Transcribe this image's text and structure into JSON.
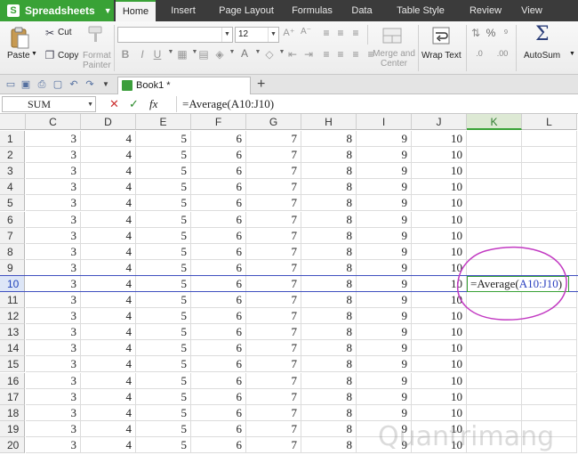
{
  "menu": {
    "app_label": "Spreadsheets",
    "tabs": [
      "Home",
      "Insert",
      "Page Layout",
      "Formulas",
      "Data",
      "Table Style",
      "Review",
      "View"
    ],
    "active_tab": "Home"
  },
  "ribbon": {
    "paste": "Paste",
    "cut": "Cut",
    "copy": "Copy",
    "format_painter": "Format Painter",
    "font_name": "",
    "font_size": "12",
    "bold": "B",
    "italic": "I",
    "underline": "U",
    "merge_center": "Merge and Center",
    "wrap_text": "Wrap Text",
    "percent": "%",
    "autosum": "AutoSum"
  },
  "document": {
    "tab_title": "Book1 *"
  },
  "formula_bar": {
    "name_box": "SUM",
    "formula": "=Average(A10:J10)",
    "cancel": "✕",
    "confirm": "✓",
    "fx": "fx"
  },
  "sheet": {
    "columns": [
      "C",
      "D",
      "E",
      "F",
      "G",
      "H",
      "I",
      "J",
      "K",
      "L"
    ],
    "selected_column": "K",
    "rows": [
      "1",
      "2",
      "3",
      "4",
      "5",
      "6",
      "7",
      "8",
      "9",
      "10",
      "11",
      "12",
      "13",
      "14",
      "15",
      "16",
      "17",
      "18",
      "19",
      "20"
    ],
    "selected_row": "10",
    "row_values": [
      "3",
      "4",
      "5",
      "6",
      "7",
      "8",
      "9",
      "10"
    ],
    "edit_cell": {
      "prefix": "=Average(",
      "ref": "A10:J10",
      "suffix": ")"
    }
  },
  "watermark": "Quantrimang",
  "colors": {
    "accent_green": "#39a236",
    "menubar_bg": "#3b3b3b",
    "selection_blue": "#4050c0",
    "annotation_magenta": "#c23ac2",
    "ref_blue": "#2a3fbf"
  }
}
